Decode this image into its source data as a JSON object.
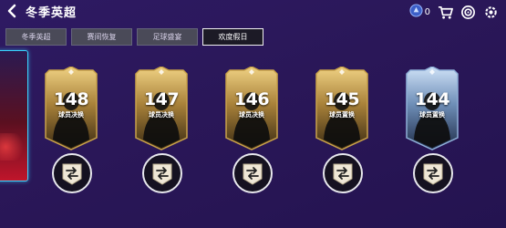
{
  "header": {
    "title": "冬季英超",
    "coin_count": "0",
    "icons": [
      "back-arrow-icon",
      "gem-icon",
      "cart-icon",
      "target-icon",
      "settings-icon"
    ]
  },
  "tabs": [
    {
      "label": "冬季英超",
      "active": false
    },
    {
      "label": "赛间恢复",
      "active": false
    },
    {
      "label": "足球盛宴",
      "active": false
    },
    {
      "label": "欢度假日",
      "active": true
    }
  ],
  "cards": [
    {
      "rating": "148",
      "label": "球员决换",
      "style": "gold"
    },
    {
      "rating": "147",
      "label": "球员决换",
      "style": "gold"
    },
    {
      "rating": "146",
      "label": "球员决换",
      "style": "gold"
    },
    {
      "rating": "145",
      "label": "球员置换",
      "style": "gold"
    },
    {
      "rating": "144",
      "label": "球员置换",
      "style": "silver"
    }
  ],
  "colors": {
    "background": "#2a1758",
    "gold_frame": "#c9a24a",
    "silver_frame": "#8fb0d8",
    "active_tab_border": "#ffffff",
    "side_card_border": "#39d6ff"
  }
}
